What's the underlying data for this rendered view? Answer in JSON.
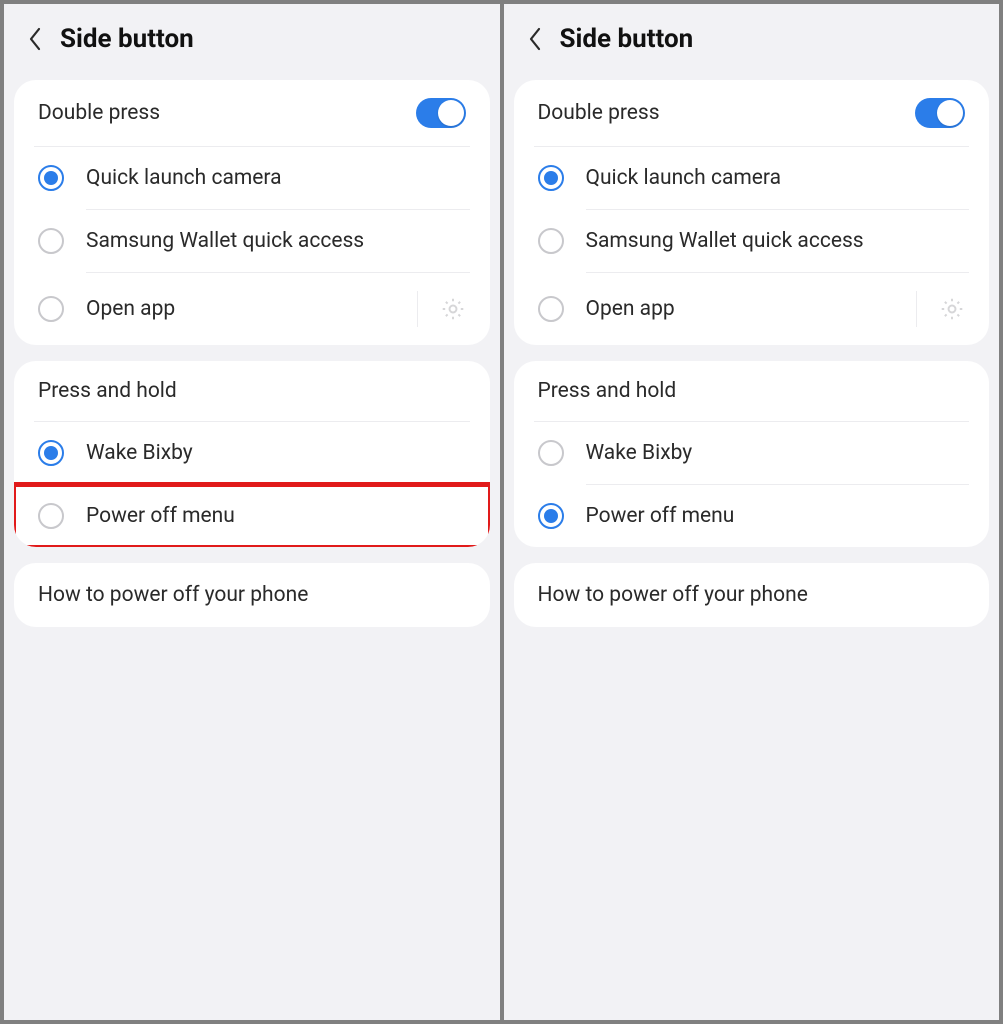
{
  "screens": [
    {
      "title": "Side button",
      "double_press": {
        "header": "Double press",
        "toggle_on": true,
        "options": [
          {
            "label": "Quick launch camera",
            "selected": true,
            "has_gear": false
          },
          {
            "label": "Samsung Wallet quick access",
            "selected": false,
            "has_gear": false
          },
          {
            "label": "Open app",
            "selected": false,
            "has_gear": true
          }
        ]
      },
      "press_hold": {
        "header": "Press and hold",
        "options": [
          {
            "label": "Wake Bixby",
            "selected": true,
            "highlight": false
          },
          {
            "label": "Power off menu",
            "selected": false,
            "highlight": true
          }
        ]
      },
      "footer_link": "How to power off your phone"
    },
    {
      "title": "Side button",
      "double_press": {
        "header": "Double press",
        "toggle_on": true,
        "options": [
          {
            "label": "Quick launch camera",
            "selected": true,
            "has_gear": false
          },
          {
            "label": "Samsung Wallet quick access",
            "selected": false,
            "has_gear": false
          },
          {
            "label": "Open app",
            "selected": false,
            "has_gear": true
          }
        ]
      },
      "press_hold": {
        "header": "Press and hold",
        "options": [
          {
            "label": "Wake Bixby",
            "selected": false,
            "highlight": false
          },
          {
            "label": "Power off menu",
            "selected": true,
            "highlight": false
          }
        ]
      },
      "footer_link": "How to power off your phone"
    }
  ]
}
